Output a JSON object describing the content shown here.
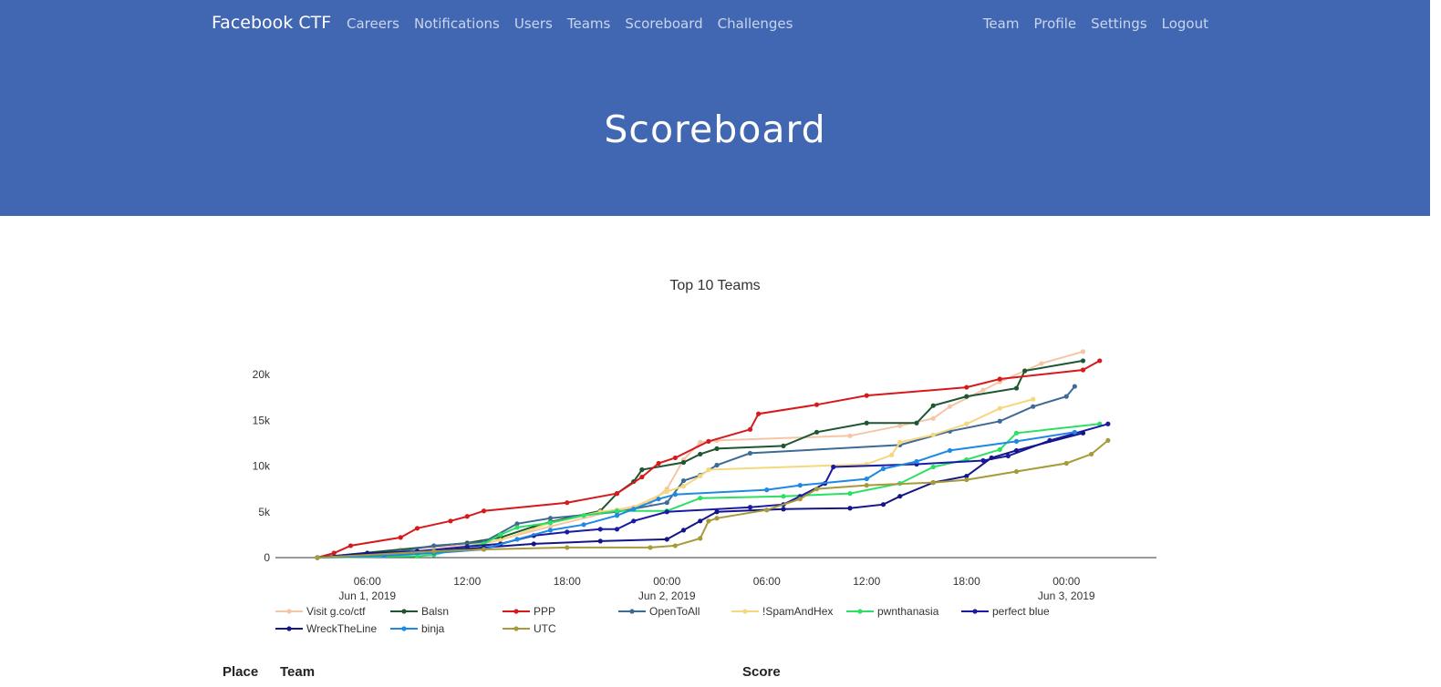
{
  "nav": {
    "brand": "Facebook CTF",
    "left": [
      "Careers",
      "Notifications",
      "Users",
      "Teams",
      "Scoreboard",
      "Challenges"
    ],
    "right": [
      "Team",
      "Profile",
      "Settings",
      "Logout"
    ]
  },
  "header": {
    "title": "Scoreboard"
  },
  "colors": {
    "hero": "#4267b2",
    "nav_text": "#c9d5ee"
  },
  "chart_data": {
    "type": "line",
    "title": "Top 10 Teams",
    "xlabel": "",
    "ylabel": "",
    "ylim": [
      0,
      22500
    ],
    "xlim": [
      "2019-06-01 03:00",
      "2019-06-03 03:00"
    ],
    "x_ticks": [
      {
        "t": "06:00",
        "d": "Jun 1, 2019"
      },
      {
        "t": "12:00",
        "d": ""
      },
      {
        "t": "18:00",
        "d": ""
      },
      {
        "t": "00:00",
        "d": "Jun 2, 2019"
      },
      {
        "t": "06:00",
        "d": ""
      },
      {
        "t": "12:00",
        "d": ""
      },
      {
        "t": "18:00",
        "d": ""
      },
      {
        "t": "00:00",
        "d": "Jun 3, 2019"
      }
    ],
    "y_ticks": [
      "0",
      "5k",
      "10k",
      "15k",
      "20k"
    ],
    "y_tick_values": [
      0,
      5000,
      10000,
      15000,
      20000
    ],
    "legend": "bottom",
    "series": [
      {
        "name": "Visit g.co/ctf",
        "color": "#f5c6a5",
        "points": [
          [
            "2019-06-01 03:00",
            0
          ],
          [
            "2019-06-01 08:00",
            900
          ],
          [
            "2019-06-01 13:00",
            1500
          ],
          [
            "2019-06-01 17:00",
            3400
          ],
          [
            "2019-06-01 21:00",
            5200
          ],
          [
            "2019-06-01 23:00",
            6000
          ],
          [
            "2019-06-02 00:00",
            7500
          ],
          [
            "2019-06-02 01:00",
            10700
          ],
          [
            "2019-06-02 02:00",
            12600
          ],
          [
            "2019-06-02 03:00",
            12800
          ],
          [
            "2019-06-02 11:00",
            13300
          ],
          [
            "2019-06-02 14:00",
            14400
          ],
          [
            "2019-06-02 16:00",
            15200
          ],
          [
            "2019-06-02 17:00",
            16500
          ],
          [
            "2019-06-02 19:00",
            18300
          ],
          [
            "2019-06-02 20:00",
            19200
          ],
          [
            "2019-06-02 21:30",
            20400
          ],
          [
            "2019-06-02 22:30",
            21200
          ],
          [
            "2019-06-03 01:00",
            22500
          ]
        ]
      },
      {
        "name": "Balsn",
        "color": "#1e5631",
        "points": [
          [
            "2019-06-01 03:00",
            0
          ],
          [
            "2019-06-01 12:00",
            1600
          ],
          [
            "2019-06-01 14:00",
            2200
          ],
          [
            "2019-06-01 16:00",
            3400
          ],
          [
            "2019-06-01 17:00",
            3900
          ],
          [
            "2019-06-01 20:00",
            5100
          ],
          [
            "2019-06-01 21:00",
            7000
          ],
          [
            "2019-06-01 22:00",
            8300
          ],
          [
            "2019-06-01 22:30",
            9600
          ],
          [
            "2019-06-02 01:00",
            10400
          ],
          [
            "2019-06-02 02:00",
            11300
          ],
          [
            "2019-06-02 03:00",
            11900
          ],
          [
            "2019-06-02 07:00",
            12200
          ],
          [
            "2019-06-02 09:00",
            13700
          ],
          [
            "2019-06-02 12:00",
            14700
          ],
          [
            "2019-06-02 15:00",
            14700
          ],
          [
            "2019-06-02 16:00",
            16600
          ],
          [
            "2019-06-02 18:00",
            17600
          ],
          [
            "2019-06-02 21:00",
            18500
          ],
          [
            "2019-06-02 21:30",
            20400
          ],
          [
            "2019-06-03 01:00",
            21500
          ]
        ]
      },
      {
        "name": "PPP",
        "color": "#d7191c",
        "points": [
          [
            "2019-06-01 03:00",
            0
          ],
          [
            "2019-06-01 04:00",
            500
          ],
          [
            "2019-06-01 05:00",
            1300
          ],
          [
            "2019-06-01 08:00",
            2200
          ],
          [
            "2019-06-01 09:00",
            3200
          ],
          [
            "2019-06-01 11:00",
            4000
          ],
          [
            "2019-06-01 12:00",
            4500
          ],
          [
            "2019-06-01 13:00",
            5100
          ],
          [
            "2019-06-01 18:00",
            6000
          ],
          [
            "2019-06-01 21:00",
            7000
          ],
          [
            "2019-06-01 22:30",
            8800
          ],
          [
            "2019-06-01 23:30",
            10300
          ],
          [
            "2019-06-02 00:30",
            10900
          ],
          [
            "2019-06-02 02:30",
            12700
          ],
          [
            "2019-06-02 05:00",
            14000
          ],
          [
            "2019-06-02 05:30",
            15700
          ],
          [
            "2019-06-02 09:00",
            16700
          ],
          [
            "2019-06-02 12:00",
            17700
          ],
          [
            "2019-06-02 18:00",
            18600
          ],
          [
            "2019-06-02 20:00",
            19500
          ],
          [
            "2019-06-03 01:00",
            20500
          ],
          [
            "2019-06-03 02:00",
            21500
          ]
        ]
      },
      {
        "name": "OpenToAll",
        "color": "#3e6a96",
        "points": [
          [
            "2019-06-01 03:00",
            0
          ],
          [
            "2019-06-01 08:00",
            700
          ],
          [
            "2019-06-01 10:00",
            1300
          ],
          [
            "2019-06-01 13:00",
            1700
          ],
          [
            "2019-06-01 15:00",
            3700
          ],
          [
            "2019-06-01 17:00",
            4300
          ],
          [
            "2019-06-01 21:00",
            5000
          ],
          [
            "2019-06-02 00:00",
            6000
          ],
          [
            "2019-06-02 01:00",
            8400
          ],
          [
            "2019-06-02 02:00",
            9000
          ],
          [
            "2019-06-02 03:00",
            10100
          ],
          [
            "2019-06-02 05:00",
            11400
          ],
          [
            "2019-06-02 14:00",
            12300
          ],
          [
            "2019-06-02 17:00",
            13800
          ],
          [
            "2019-06-02 20:00",
            14900
          ],
          [
            "2019-06-02 22:00",
            16500
          ],
          [
            "2019-06-03 00:00",
            17600
          ],
          [
            "2019-06-03 00:30",
            18700
          ]
        ]
      },
      {
        "name": "!SpamAndHex",
        "color": "#f5d77e",
        "points": [
          [
            "2019-06-01 03:00",
            0
          ],
          [
            "2019-06-01 10:00",
            600
          ],
          [
            "2019-06-01 14:00",
            1900
          ],
          [
            "2019-06-01 17:00",
            3800
          ],
          [
            "2019-06-01 20:00",
            5000
          ],
          [
            "2019-06-01 22:00",
            5500
          ],
          [
            "2019-06-02 00:00",
            7200
          ],
          [
            "2019-06-02 01:00",
            7800
          ],
          [
            "2019-06-02 02:00",
            8900
          ],
          [
            "2019-06-02 02:30",
            9600
          ],
          [
            "2019-06-02 12:00",
            10200
          ],
          [
            "2019-06-02 13:30",
            11200
          ],
          [
            "2019-06-02 14:00",
            12600
          ],
          [
            "2019-06-02 16:00",
            13400
          ],
          [
            "2019-06-02 18:00",
            14600
          ],
          [
            "2019-06-02 20:00",
            16300
          ],
          [
            "2019-06-02 22:00",
            17300
          ]
        ]
      },
      {
        "name": "pwnthanasia",
        "color": "#2be062",
        "points": [
          [
            "2019-06-01 03:00",
            0
          ],
          [
            "2019-06-01 09:00",
            150
          ],
          [
            "2019-06-01 10:00",
            300
          ],
          [
            "2019-06-01 12:00",
            1200
          ],
          [
            "2019-06-01 13:00",
            1500
          ],
          [
            "2019-06-01 14:00",
            2500
          ],
          [
            "2019-06-01 15:00",
            3300
          ],
          [
            "2019-06-01 17:00",
            3800
          ],
          [
            "2019-06-01 19:00",
            4600
          ],
          [
            "2019-06-01 21:00",
            5100
          ],
          [
            "2019-06-02 00:00",
            5100
          ],
          [
            "2019-06-02 02:00",
            6500
          ],
          [
            "2019-06-02 07:00",
            6700
          ],
          [
            "2019-06-02 11:00",
            7000
          ],
          [
            "2019-06-02 14:00",
            8100
          ],
          [
            "2019-06-02 16:00",
            9900
          ],
          [
            "2019-06-02 18:00",
            10700
          ],
          [
            "2019-06-02 20:00",
            11800
          ],
          [
            "2019-06-02 21:00",
            13600
          ],
          [
            "2019-06-03 02:00",
            14600
          ]
        ]
      },
      {
        "name": "perfect blue",
        "color": "#1a1aa3",
        "points": [
          [
            "2019-06-01 03:00",
            0
          ],
          [
            "2019-06-01 06:00",
            400
          ],
          [
            "2019-06-01 09:00",
            700
          ],
          [
            "2019-06-01 12:00",
            1200
          ],
          [
            "2019-06-01 14:00",
            1500
          ],
          [
            "2019-06-01 16:00",
            2400
          ],
          [
            "2019-06-01 18:00",
            2800
          ],
          [
            "2019-06-01 20:00",
            3100
          ],
          [
            "2019-06-01 21:00",
            3100
          ],
          [
            "2019-06-01 22:00",
            4000
          ],
          [
            "2019-06-02 00:00",
            5000
          ],
          [
            "2019-06-02 05:00",
            5500
          ],
          [
            "2019-06-02 07:00",
            5800
          ],
          [
            "2019-06-02 08:00",
            6700
          ],
          [
            "2019-06-02 09:30",
            8100
          ],
          [
            "2019-06-02 10:00",
            9900
          ],
          [
            "2019-06-02 15:00",
            10200
          ],
          [
            "2019-06-02 19:00",
            10600
          ],
          [
            "2019-06-02 20:30",
            11100
          ],
          [
            "2019-06-02 23:00",
            12800
          ],
          [
            "2019-06-03 02:30",
            14600
          ]
        ]
      },
      {
        "name": "WreckTheLine",
        "color": "#15158a",
        "points": [
          [
            "2019-06-01 03:00",
            0
          ],
          [
            "2019-06-01 06:00",
            500
          ],
          [
            "2019-06-01 10:00",
            700
          ],
          [
            "2019-06-01 13:00",
            1100
          ],
          [
            "2019-06-01 16:00",
            1500
          ],
          [
            "2019-06-01 20:00",
            1800
          ],
          [
            "2019-06-02 00:00",
            2000
          ],
          [
            "2019-06-02 01:00",
            3000
          ],
          [
            "2019-06-02 02:00",
            4000
          ],
          [
            "2019-06-02 03:00",
            5000
          ],
          [
            "2019-06-02 07:00",
            5300
          ],
          [
            "2019-06-02 11:00",
            5400
          ],
          [
            "2019-06-02 13:00",
            5800
          ],
          [
            "2019-06-02 14:00",
            6700
          ],
          [
            "2019-06-02 16:00",
            8200
          ],
          [
            "2019-06-02 18:00",
            8900
          ],
          [
            "2019-06-02 19:30",
            10900
          ],
          [
            "2019-06-02 21:00",
            11700
          ],
          [
            "2019-06-03 01:00",
            13600
          ]
        ]
      },
      {
        "name": "binja",
        "color": "#1e88e5",
        "points": [
          [
            "2019-06-01 03:00",
            0
          ],
          [
            "2019-06-01 07:00",
            200
          ],
          [
            "2019-06-01 10:00",
            500
          ],
          [
            "2019-06-01 13:00",
            900
          ],
          [
            "2019-06-01 15:00",
            2000
          ],
          [
            "2019-06-01 17:00",
            3000
          ],
          [
            "2019-06-01 19:00",
            3600
          ],
          [
            "2019-06-01 21:00",
            4600
          ],
          [
            "2019-06-01 22:00",
            5300
          ],
          [
            "2019-06-01 23:30",
            6400
          ],
          [
            "2019-06-02 00:30",
            6900
          ],
          [
            "2019-06-02 06:00",
            7400
          ],
          [
            "2019-06-02 08:00",
            7900
          ],
          [
            "2019-06-02 12:00",
            8600
          ],
          [
            "2019-06-02 13:00",
            9700
          ],
          [
            "2019-06-02 15:00",
            10500
          ],
          [
            "2019-06-02 17:00",
            11700
          ],
          [
            "2019-06-02 21:00",
            12700
          ],
          [
            "2019-06-03 00:30",
            13700
          ]
        ]
      },
      {
        "name": "UTC",
        "color": "#a69a3a",
        "points": [
          [
            "2019-06-01 03:00",
            0
          ],
          [
            "2019-06-01 10:00",
            700
          ],
          [
            "2019-06-01 13:00",
            900
          ],
          [
            "2019-06-01 18:00",
            1100
          ],
          [
            "2019-06-01 23:00",
            1100
          ],
          [
            "2019-06-02 00:30",
            1300
          ],
          [
            "2019-06-02 02:00",
            2100
          ],
          [
            "2019-06-02 02:30",
            4000
          ],
          [
            "2019-06-02 03:00",
            4300
          ],
          [
            "2019-06-02 06:00",
            5200
          ],
          [
            "2019-06-02 08:00",
            6400
          ],
          [
            "2019-06-02 09:00",
            7500
          ],
          [
            "2019-06-02 12:00",
            7900
          ],
          [
            "2019-06-02 16:00",
            8200
          ],
          [
            "2019-06-02 18:00",
            8500
          ],
          [
            "2019-06-02 21:00",
            9400
          ],
          [
            "2019-06-03 00:00",
            10300
          ],
          [
            "2019-06-03 01:30",
            11300
          ],
          [
            "2019-06-03 02:30",
            12800
          ]
        ]
      }
    ]
  },
  "table": {
    "headers": {
      "place": "Place",
      "team": "Team",
      "score": "Score"
    }
  }
}
